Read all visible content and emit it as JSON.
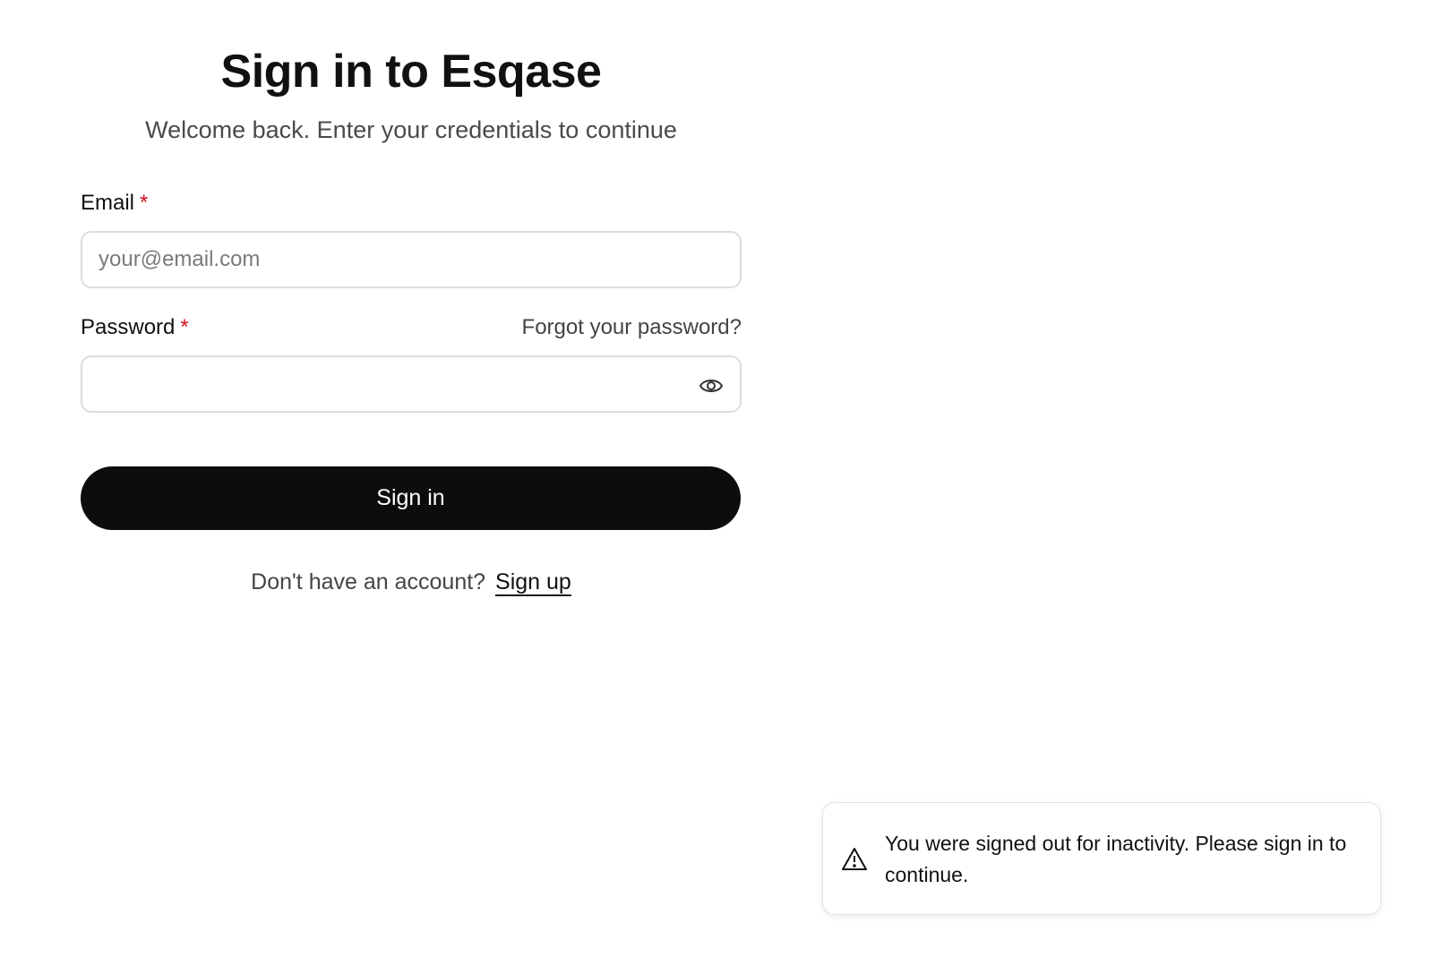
{
  "signin": {
    "title": "Sign in to Esqase",
    "subtitle": "Welcome back. Enter your credentials to continue",
    "email": {
      "label": "Email",
      "required_mark": "*",
      "placeholder": "your@email.com",
      "value": ""
    },
    "password": {
      "label": "Password",
      "required_mark": "*",
      "forgot_link": "Forgot your password?",
      "value": "",
      "toggle_icon": "eye-icon"
    },
    "submit_label": "Sign in",
    "signup_prompt": "Don't have an account?",
    "signup_link": "Sign up"
  },
  "toast": {
    "icon": "warning-icon",
    "message": "You were signed out for inactivity. Please sign in to continue."
  },
  "colors": {
    "primary_button": "#0d0d0d",
    "required": "#d10f1f",
    "border": "#dddddd"
  }
}
